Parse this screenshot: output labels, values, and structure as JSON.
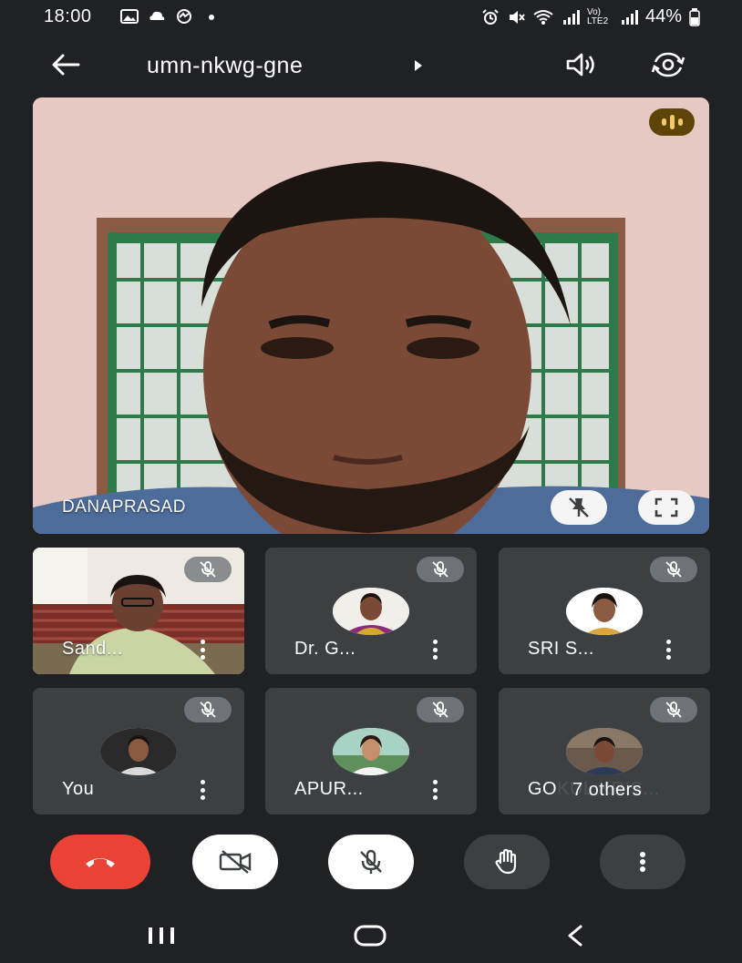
{
  "status_bar": {
    "time": "18:00",
    "battery": "44%",
    "network": "Vo) LTE2",
    "icons": [
      "gallery-icon",
      "cloud-sync-icon",
      "link-icon",
      "dot-icon",
      "alarm-icon",
      "mute-icon",
      "wifi-icon",
      "signal-icon",
      "battery-icon"
    ]
  },
  "header": {
    "meeting_code": "umn-nkwg-gne",
    "back_icon": "arrow-left-icon",
    "audio_icon": "speaker-icon",
    "switch_camera_icon": "flip-camera-icon"
  },
  "main_participant": {
    "name": "DANAPRASAD",
    "speaking": true,
    "pin_icon": "unpin-icon",
    "fullscreen_icon": "fullscreen-icon"
  },
  "participants": [
    {
      "name": "Sand...",
      "muted": true,
      "video": true
    },
    {
      "name": "Dr. G...",
      "muted": true,
      "video": false
    },
    {
      "name": "SRI S...",
      "muted": true,
      "video": false
    },
    {
      "name": "You",
      "muted": true,
      "video": false
    },
    {
      "name": "APUR...",
      "muted": true,
      "video": false
    },
    {
      "name": "GOKUL KRIS...",
      "muted": true,
      "video": false
    }
  ],
  "others_label": "7 others",
  "controls": {
    "end_call_color": "#ea4335",
    "items": [
      "end-call-button",
      "camera-off-button",
      "mic-off-button",
      "raise-hand-button",
      "more-options-button"
    ]
  },
  "colors": {
    "background": "#202124",
    "tile": "#3c4043",
    "speaking_badge": "#5d4509"
  }
}
